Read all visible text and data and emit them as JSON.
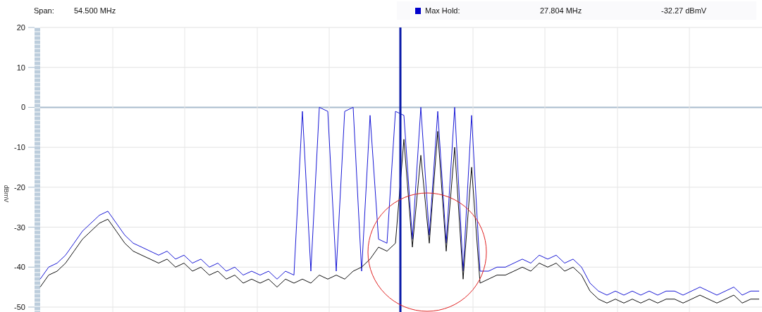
{
  "header": {
    "span_label": "Span:",
    "span_value": "54.500 MHz",
    "marker_label": "Max Hold:",
    "marker_frequency": "27.804 MHz",
    "marker_level": "-32.27 dBmV"
  },
  "chart_data": {
    "type": "line",
    "grid": true,
    "ylabel": "dBmV",
    "ylim": [
      -50,
      20
    ],
    "yticks": [
      20,
      10,
      0,
      -10,
      -20,
      -30,
      -40,
      -50
    ],
    "series": [
      {
        "color": "#1a1ad6",
        "values": [
          -43,
          -40,
          -39,
          -37,
          -34,
          -31,
          -29,
          -27,
          -26,
          -29,
          -32,
          -34,
          -35,
          -36,
          -37,
          -36,
          -38,
          -37,
          -39,
          -38,
          -40,
          -39,
          -41,
          -40,
          -42,
          -41,
          -42,
          -41,
          -43,
          -41,
          -42,
          -1,
          -41,
          0,
          -1,
          -41,
          -1,
          0,
          -41,
          -2,
          -33,
          -34,
          -1,
          -2,
          -33,
          0,
          -32,
          -1,
          -34,
          0,
          -41,
          -2,
          -41,
          -41,
          -40,
          -40,
          -39,
          -38,
          -39,
          -37,
          -38,
          -37,
          -39,
          -38,
          -40,
          -44,
          -46,
          -47,
          -46,
          -47,
          -46,
          -47,
          -46,
          -47,
          -46,
          -46,
          -47,
          -46,
          -45,
          -46,
          -47,
          -46,
          -45,
          -47,
          -46,
          -46
        ]
      },
      {
        "color": "#111111",
        "values": [
          -45,
          -42,
          -41,
          -39,
          -36,
          -33,
          -31,
          -29,
          -28,
          -31,
          -34,
          -36,
          -37,
          -38,
          -39,
          -38,
          -40,
          -39,
          -41,
          -40,
          -42,
          -41,
          -43,
          -42,
          -44,
          -43,
          -44,
          -43,
          -45,
          -43,
          -44,
          -43,
          -44,
          -42,
          -43,
          -42,
          -43,
          -41,
          -40,
          -38,
          -35,
          -36,
          -34,
          -8,
          -35,
          -12,
          -34,
          -6,
          -36,
          -10,
          -43,
          -15,
          -44,
          -43,
          -42,
          -42,
          -41,
          -40,
          -41,
          -39,
          -40,
          -39,
          -41,
          -40,
          -42,
          -46,
          -48,
          -49,
          -48,
          -49,
          -48,
          -49,
          -48,
          -49,
          -48,
          -48,
          -49,
          -48,
          -47,
          -48,
          -49,
          -48,
          -47,
          -49,
          -48,
          -48
        ]
      }
    ]
  }
}
